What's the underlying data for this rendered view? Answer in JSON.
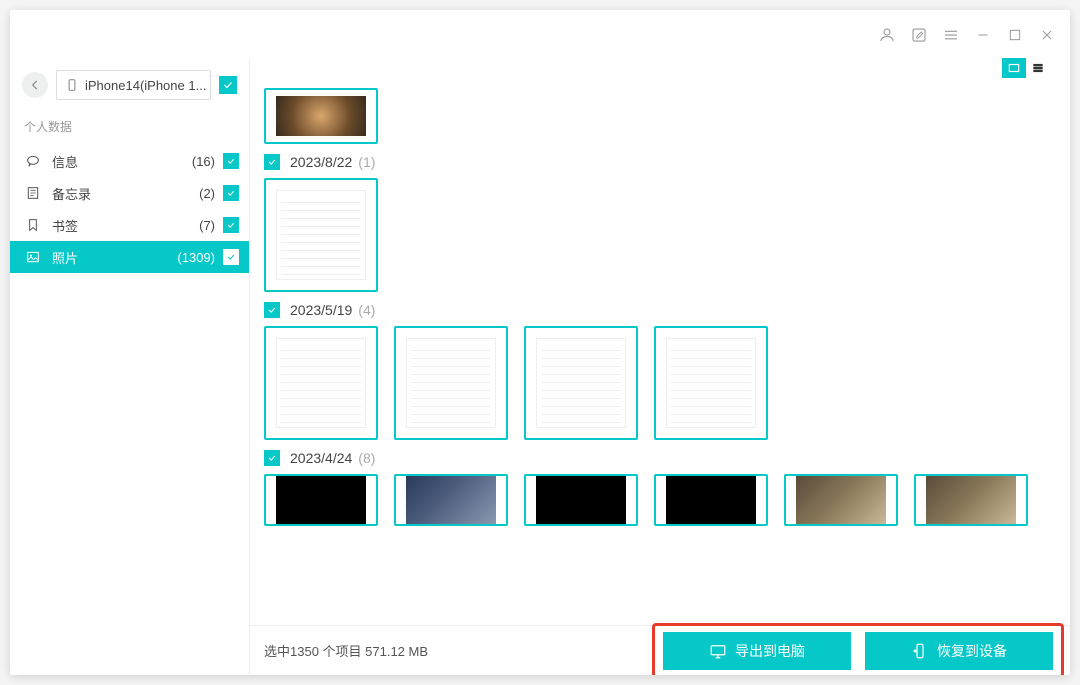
{
  "titlebar": {
    "icons": [
      "user",
      "edit",
      "menu",
      "minimize",
      "maximize",
      "close"
    ]
  },
  "device": {
    "name": "iPhone14(iPhone 1..."
  },
  "sidebar": {
    "section_title": "个人数据",
    "items": [
      {
        "icon": "message",
        "label": "信息",
        "count": "(16)"
      },
      {
        "icon": "note",
        "label": "备忘录",
        "count": "(2)"
      },
      {
        "icon": "bookmark",
        "label": "书签",
        "count": "(7)"
      },
      {
        "icon": "photo",
        "label": "照片",
        "count": "(1309)"
      }
    ]
  },
  "groups": [
    {
      "date": "2023/8/22",
      "count": "(1)",
      "thumbs": [
        {
          "type": "settings-list"
        }
      ]
    },
    {
      "date": "2023/5/19",
      "count": "(4)",
      "thumbs": [
        {
          "type": "settings-list"
        },
        {
          "type": "settings-list"
        },
        {
          "type": "settings-list"
        },
        {
          "type": "settings-list"
        }
      ]
    },
    {
      "date": "2023/4/24",
      "count": "(8)",
      "thumbs": [
        {
          "type": "dark"
        },
        {
          "type": "sky"
        },
        {
          "type": "dark"
        },
        {
          "type": "dark"
        },
        {
          "type": "warm"
        },
        {
          "type": "warm"
        }
      ]
    }
  ],
  "footer": {
    "status": "选中1350 个项目 571.12 MB",
    "export_label": "导出到电脑",
    "restore_label": "恢复到设备"
  },
  "top_strip_thumb": {
    "type": "blur1"
  }
}
